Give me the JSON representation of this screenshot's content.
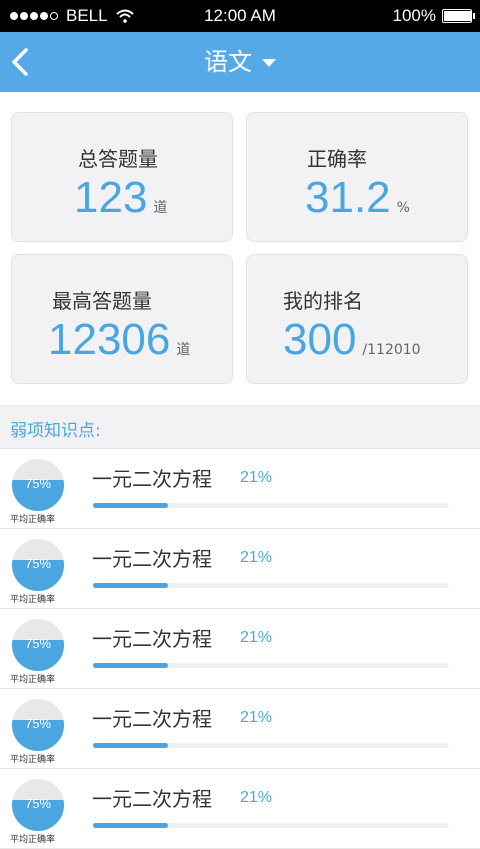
{
  "status_bar": {
    "carrier": "BELL",
    "signal_dots": [
      true,
      true,
      true,
      true,
      false
    ],
    "time": "12:00 AM",
    "battery": "100%",
    "battery_level": 1.0
  },
  "nav": {
    "back_icon": "chevron-left-icon",
    "title": "语文",
    "dropdown_icon": "caret-down-icon"
  },
  "stats": {
    "total": {
      "label": "总答题量",
      "value": "123",
      "unit": "道"
    },
    "accuracy": {
      "label": "正确率",
      "value": "31.2",
      "unit": "%"
    },
    "max": {
      "label": "最高答题量",
      "value": "12306",
      "unit": "道"
    },
    "rank": {
      "label": "我的排名",
      "value": "300",
      "unit": "/112010"
    }
  },
  "weak": {
    "header": "弱项知识点:",
    "items": [
      {
        "gauge_text": "75%",
        "gauge_level": 0.6,
        "gauge_label": "平均正确率",
        "name": "一元二次方程",
        "rate": "21%",
        "rate_value": 0.21
      },
      {
        "gauge_text": "75%",
        "gauge_level": 0.6,
        "gauge_label": "平均正确率",
        "name": "一元二次方程",
        "rate": "21%",
        "rate_value": 0.21
      },
      {
        "gauge_text": "75%",
        "gauge_level": 0.6,
        "gauge_label": "平均正确率",
        "name": "一元二次方程",
        "rate": "21%",
        "rate_value": 0.21
      },
      {
        "gauge_text": "75%",
        "gauge_level": 0.6,
        "gauge_label": "平均正确率",
        "name": "一元二次方程",
        "rate": "21%",
        "rate_value": 0.21
      },
      {
        "gauge_text": "75%",
        "gauge_level": 0.6,
        "gauge_label": "平均正确率",
        "name": "一元二次方程",
        "rate": "21%",
        "rate_value": 0.21
      }
    ]
  },
  "colors": {
    "accent": "#4aa6e0",
    "navbar": "#55a9e6",
    "card_bg": "#f2f2f4"
  }
}
